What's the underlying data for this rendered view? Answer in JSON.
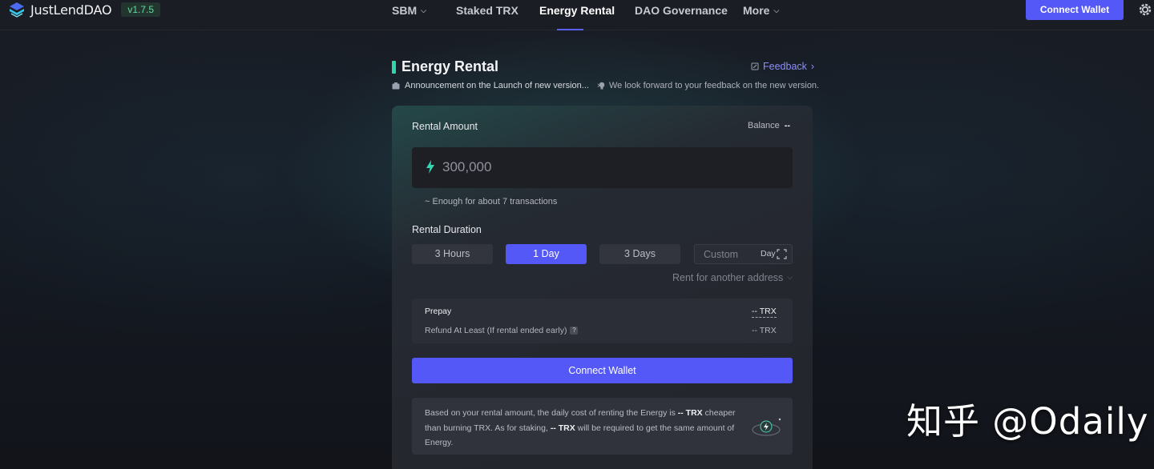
{
  "nav": {
    "brand": "JustLendDAO",
    "version": "v1.7.5",
    "items": [
      "SBM",
      "Staked TRX",
      "Energy Rental",
      "DAO Governance",
      "More"
    ],
    "active": "Energy Rental",
    "connect_label": "Connect Wallet"
  },
  "page": {
    "title": "Energy Rental",
    "feedback_label": "Feedback",
    "announcement": "Announcement on the Launch of new version...",
    "feedback_note": "We look forward to your feedback on the new version."
  },
  "form": {
    "rental_amount_label": "Rental Amount",
    "balance_label": "Balance",
    "balance_value": "--",
    "amount_placeholder": "300,000",
    "amount_hint": "~ Enough for about 7 transactions",
    "duration_label": "Rental Duration",
    "durations": [
      "3 Hours",
      "1 Day",
      "3 Days"
    ],
    "selected_duration": "1 Day",
    "custom_placeholder": "Custom",
    "custom_unit": "Day",
    "another_address": "Rent for another address",
    "prepay_label": "Prepay",
    "prepay_value": "-- TRX",
    "refund_label": "Refund At Least (If rental ended early)",
    "refund_value": "-- TRX",
    "connect_label": "Connect Wallet"
  },
  "info": {
    "part1": "Based on your rental amount, the daily cost of renting the Energy is ",
    "value1": "-- TRX",
    "part2": " cheaper than burning TRX. As for staking, ",
    "value2": "-- TRX",
    "part3": " will be required to get the same amount of Energy."
  },
  "watermark": "知乎 @Odaily",
  "colors": {
    "accent": "#5458f6",
    "title_bar": "#2fd5ad",
    "version_text": "#6ad7a3",
    "feedback": "#8b8ff8"
  }
}
